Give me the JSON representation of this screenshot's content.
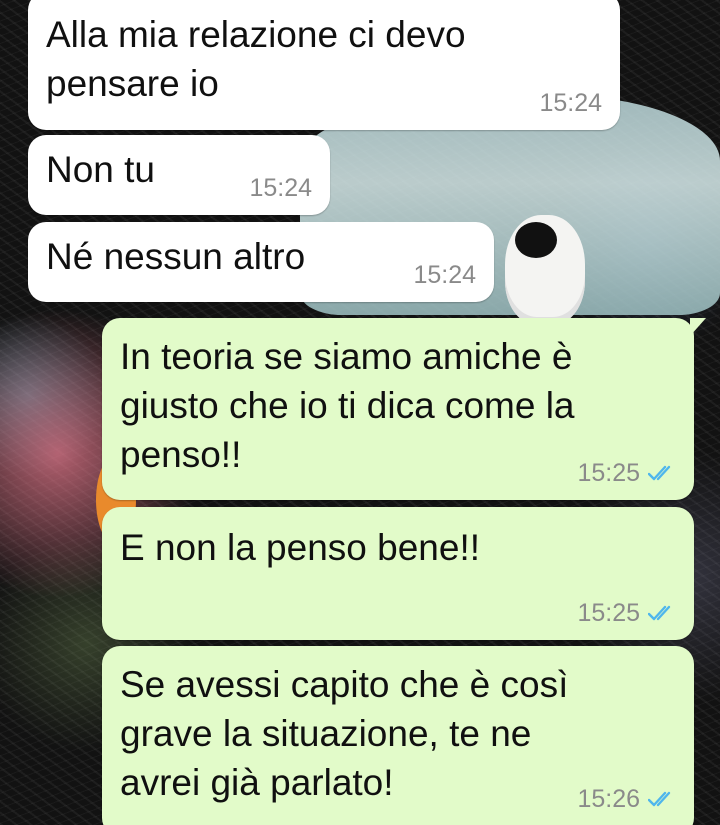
{
  "chat": {
    "messages": [
      {
        "direction": "incoming",
        "text": "Alla mia relazione ci devo\npensare io",
        "time": "15:24"
      },
      {
        "direction": "incoming",
        "text": "Non tu",
        "time": "15:24"
      },
      {
        "direction": "incoming",
        "text": "Né nessun altro",
        "time": "15:24"
      },
      {
        "direction": "outgoing",
        "text": "In teoria se siamo amiche è\ngiusto che io ti dica come la\npenso!!",
        "time": "15:25",
        "status": "read"
      },
      {
        "direction": "outgoing",
        "text": "E non la penso bene!!",
        "time": "15:25",
        "status": "read"
      },
      {
        "direction": "outgoing",
        "text": "Se avessi capito che è così\ngrave la situazione, te ne\navrei già parlato!",
        "time": "15:26",
        "status": "read"
      }
    ]
  },
  "colors": {
    "incoming_bubble": "#ffffff",
    "outgoing_bubble": "#e2fbc9",
    "read_ticks": "#4fb6ec",
    "timestamp": "#8a8a8a"
  },
  "icons": {
    "read_status": "double-check-icon"
  }
}
